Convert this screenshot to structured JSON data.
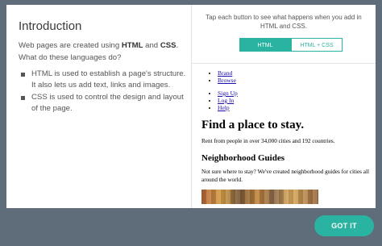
{
  "left_panel": {
    "title": "Introduction",
    "intro_prefix": "Web pages are created using ",
    "intro_html": "HTML",
    "intro_and": " and ",
    "intro_css": "CSS",
    "intro_suffix": ". What do these languages do?",
    "bullets": [
      "HTML is used to establish a page's structure. It also lets us add text, links and images.",
      "CSS is used to control the design and layout of the page."
    ]
  },
  "right_panel": {
    "hint": "Tap each button to see what happens when you add in HTML and CSS.",
    "buttons": {
      "html_label": "HTML",
      "html_css_label": "HTML + CSS"
    },
    "preview": {
      "nav1": [
        "Brand",
        "Browse"
      ],
      "nav2": [
        "Sign Up",
        "Log In",
        "Help"
      ],
      "headline": "Find a place to stay.",
      "subtext": "Rent from people in over 34,000 cities and 192 countries.",
      "section_title": "Neighborhood Guides",
      "section_text": "Not sure where to stay? We've created neighborhood guides for cities all around the world."
    }
  },
  "footer": {
    "got_it_label": "GOT IT"
  },
  "colors": {
    "accent": "#2ab3a0",
    "backdrop": "#5e6d79",
    "link": "#1a0dab"
  }
}
